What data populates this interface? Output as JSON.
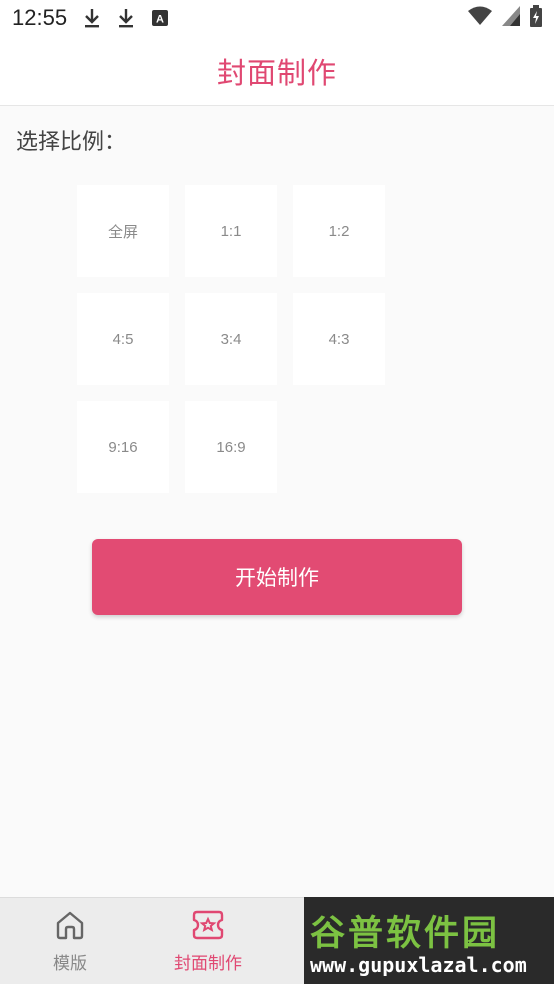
{
  "status_bar": {
    "time": "12:55",
    "icons": [
      "download-icon",
      "download-icon",
      "font-icon",
      "wifi-icon",
      "signal-icon",
      "battery-icon"
    ]
  },
  "app_bar": {
    "title": "封面制作"
  },
  "section": {
    "label": "选择比例："
  },
  "ratios": [
    "全屏",
    "1:1",
    "1:2",
    "4:5",
    "3:4",
    "4:3",
    "9:16",
    "16:9"
  ],
  "start_button": {
    "label": "开始制作"
  },
  "bottom_nav": {
    "items": [
      {
        "label": "模版",
        "icon": "home-icon",
        "active": false
      },
      {
        "label": "封面制作",
        "icon": "cover-icon",
        "active": true
      }
    ]
  },
  "watermark": {
    "title": "谷普软件园",
    "url": "www.gupuxlazal.com"
  },
  "colors": {
    "accent": "#e24b73",
    "title": "#e04872",
    "background": "#fafafa"
  }
}
